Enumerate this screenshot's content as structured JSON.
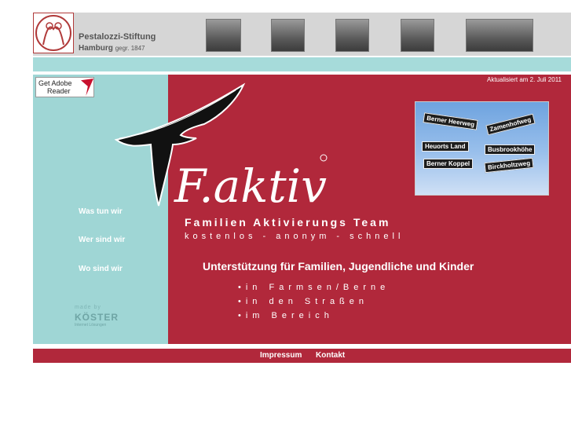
{
  "header": {
    "org_name": "Pestalozzi-Stiftung",
    "org_city": "Hamburg",
    "org_founded": "gegr. 1847"
  },
  "adobe": {
    "get_label": "Get Adobe",
    "reader_label": "Reader"
  },
  "updated": "Aktualisiert am 2. Juli  2011",
  "nav": {
    "items": [
      "Was tun wir",
      "Wer sind wir",
      "Wo sind wir"
    ]
  },
  "made_by": {
    "label": "made by",
    "brand": "KÖSTER",
    "tagline": "Internet Lösungen"
  },
  "logo_text": "F.aktiv",
  "team": {
    "title": "Familien Aktivierungs Team",
    "subtitle": "kostenlos - anonym - schnell"
  },
  "support_heading": "Unterstützung für Familien, Jugendliche und Kinder",
  "bullets": [
    "in Farmsen/Berne",
    "in den Straßen",
    "im Bereich"
  ],
  "signs": [
    "Berner Heerweg",
    "Zamenhofweg",
    "Heuorts Land",
    "Busbrookhöhe",
    "Berner Koppel",
    "Birckholtzweg"
  ],
  "footer": {
    "impressum": "Impressum",
    "kontakt": "Kontakt"
  },
  "colors": {
    "main_red": "#b1283b",
    "teal": "#9fd6d5",
    "header_gray": "#d6d6d6"
  }
}
